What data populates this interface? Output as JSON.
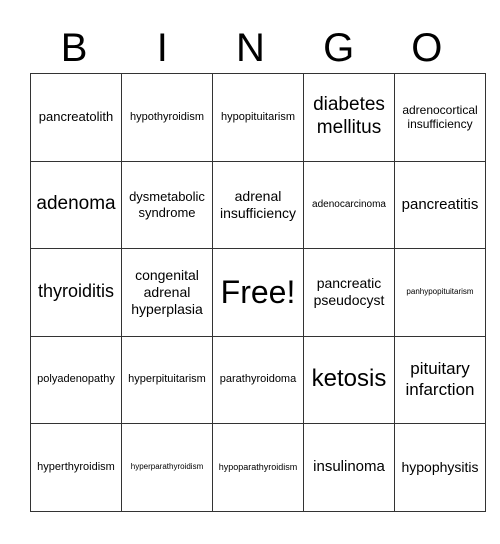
{
  "header": [
    "B",
    "I",
    "N",
    "G",
    "O"
  ],
  "cells": [
    [
      "pancreatolith",
      "hypothyroidism",
      "hypopituitarism",
      "diabetes mellitus",
      "adrenocortical insufficiency"
    ],
    [
      "adenoma",
      "dysmetabolic syndrome",
      "adrenal insufficiency",
      "adenocarcinoma",
      "pancreatitis"
    ],
    [
      "thyroiditis",
      "congenital adrenal hyperplasia",
      "Free!",
      "pancreatic pseudocyst",
      "panhypopituitarism"
    ],
    [
      "polyadenopathy",
      "hyperpituitarism",
      "parathyroidoma",
      "ketosis",
      "pituitary infarction"
    ],
    [
      "hyperthyroidism",
      "hyperparathyroidism",
      "hypoparathyroidism",
      "insulinoma",
      "hypophysitis"
    ]
  ]
}
